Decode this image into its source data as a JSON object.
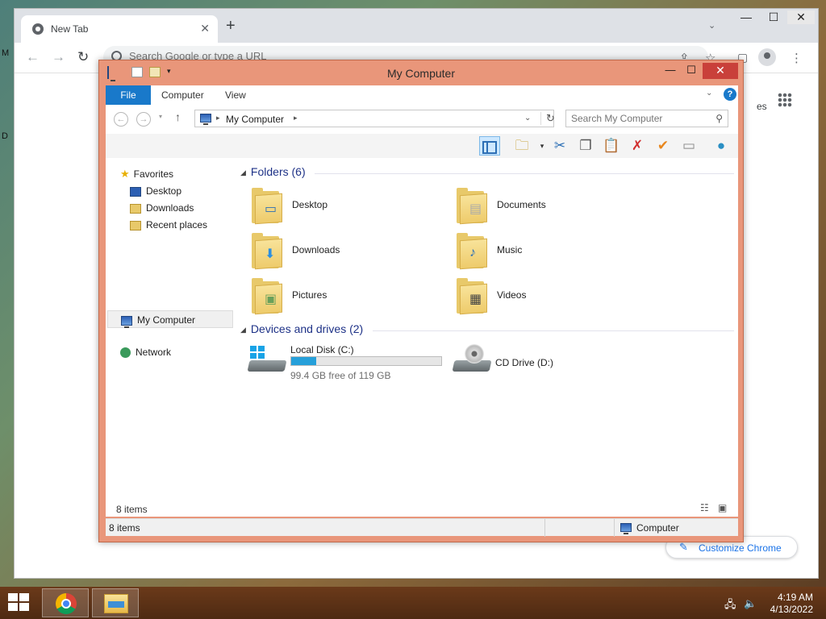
{
  "desktop": {
    "left_letters": [
      "M",
      "D"
    ]
  },
  "chrome": {
    "tab_title": "New Tab",
    "tab_close": "✕",
    "new_tab": "+",
    "tab_dropdown": "⌄",
    "win_controls": [
      "—",
      "☐",
      "✕"
    ],
    "nav": {
      "back": "←",
      "forward": "→",
      "reload": "↻"
    },
    "omnibox_placeholder": "Search Google or type a URL",
    "ntp_fragment": "es",
    "customize_label": "Customize Chrome"
  },
  "explorer": {
    "title": "My Computer",
    "win_controls": [
      "—",
      "☐",
      "✕"
    ],
    "ribbon_tabs": [
      "File",
      "Computer",
      "View"
    ],
    "address": {
      "crumb": "My Computer"
    },
    "search_placeholder": "Search My Computer",
    "nav_pane": {
      "favorites": "Favorites",
      "favorites_items": [
        "Desktop",
        "Downloads",
        "Recent places"
      ],
      "my_computer": "My Computer",
      "network": "Network"
    },
    "groups": {
      "folders": "Folders (6)",
      "devices": "Devices and drives (2)"
    },
    "folders": [
      "Desktop",
      "Documents",
      "Downloads",
      "Music",
      "Pictures",
      "Videos"
    ],
    "drives": [
      {
        "name": "Local Disk (C:)",
        "free_text": "99.4 GB free of 119 GB",
        "used_fraction": 0.165
      },
      {
        "name": "CD Drive (D:)"
      }
    ],
    "content_footer": "8 items",
    "status": {
      "left": "8 items",
      "right": "Computer"
    }
  },
  "taskbar": {
    "time": "4:19 AM",
    "date": "4/13/2022"
  },
  "colors": {
    "explorer_frame": "#e9967a",
    "file_tab": "#1979ca",
    "group_header": "#1e3287",
    "disk_fill": "#26a0da",
    "close_button": "#c9403a"
  }
}
